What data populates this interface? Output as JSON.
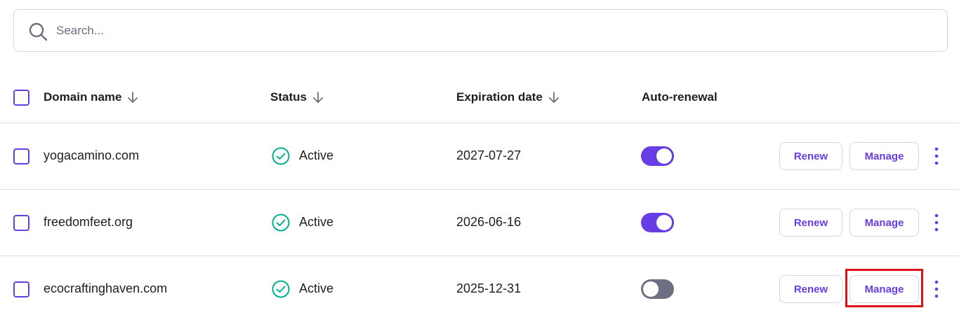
{
  "search": {
    "placeholder": "Search..."
  },
  "table": {
    "headers": {
      "domain": "Domain name",
      "status": "Status",
      "expiration": "Expiration date",
      "auto_renewal": "Auto-renewal"
    },
    "rows": [
      {
        "domain": "yogacamino.com",
        "status": "Active",
        "expiration": "2027-07-27",
        "auto_renewal": true,
        "renew": "Renew",
        "manage": "Manage"
      },
      {
        "domain": "freedomfeet.org",
        "status": "Active",
        "expiration": "2026-06-16",
        "auto_renewal": true,
        "renew": "Renew",
        "manage": "Manage"
      },
      {
        "domain": "ecocraftinghaven.com",
        "status": "Active",
        "expiration": "2025-12-31",
        "auto_renewal": false,
        "renew": "Renew",
        "manage": "Manage"
      }
    ]
  },
  "colors": {
    "accent": "#673de6",
    "success": "#00b090",
    "toggle_off": "#6d7081",
    "highlight": "#e0101a"
  },
  "icons": {
    "search": "search-icon",
    "sort": "arrow-down-icon",
    "status": "check-circle-icon",
    "more": "kebab-menu-icon"
  }
}
